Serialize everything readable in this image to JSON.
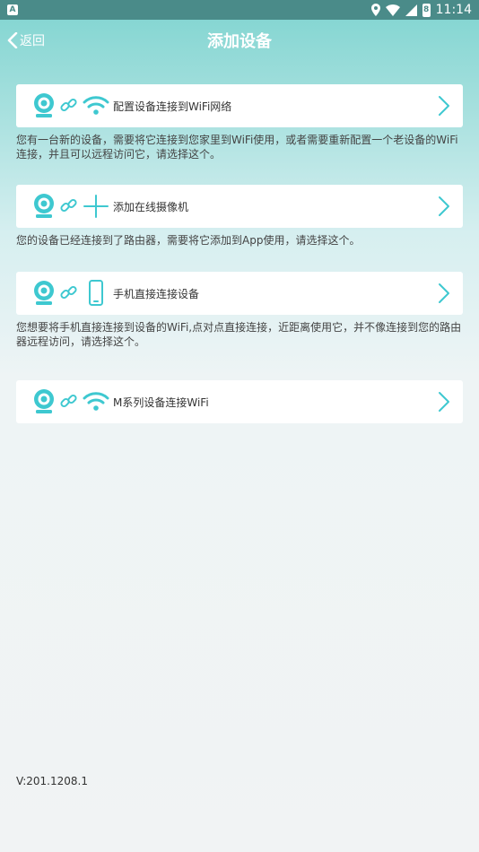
{
  "status_bar": {
    "left_icon_letter": "A",
    "time": "11:14",
    "battery_level": "8"
  },
  "header": {
    "back_label": "返回",
    "title": "添加设备"
  },
  "options": [
    {
      "label": "配置设备连接到WiFi网络",
      "icons": [
        "camera-icon",
        "link-icon",
        "wifi-icon"
      ],
      "description": "您有一台新的设备，需要将它连接到您家里到WiFi使用，或者需要重新配置一个老设备的WiFi连接，并且可以远程访问它，请选择这个。"
    },
    {
      "label": "添加在线摄像机",
      "icons": [
        "camera-icon",
        "link-icon",
        "plus-icon"
      ],
      "description": "您的设备已经连接到了路由器，需要将它添加到App使用，请选择这个。"
    },
    {
      "label": "手机直接连接设备",
      "icons": [
        "camera-icon",
        "link-icon",
        "phone-icon"
      ],
      "description": "您想要将手机直接连接到设备的WiFi,点对点直接连接，近距离使用它，并不像连接到您的路由器远程访问，请选择这个。"
    },
    {
      "label": "M系列设备连接WiFi",
      "icons": [
        "camera-icon",
        "link-icon",
        "wifi-icon"
      ],
      "description": ""
    }
  ],
  "version": "V:201.1208.1",
  "colors": {
    "accent": "#3ec8d0",
    "header_top": "#7fd4d0",
    "status_bar": "#4a8b89"
  }
}
